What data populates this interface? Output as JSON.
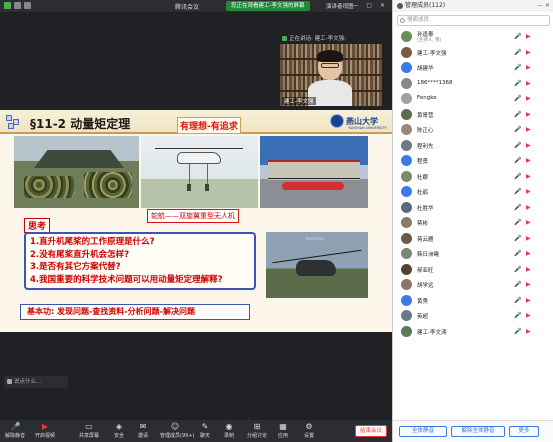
{
  "window": {
    "app_title": "腾讯会议",
    "banner": "您正在观看建工-李文强的屏幕",
    "gallery_button": "演讲者视图"
  },
  "speaker": {
    "label": "正在讲话: 建工-李文强;",
    "video_name": "建工-李文强"
  },
  "slide": {
    "title": "§11-2 动量矩定理",
    "tagline": "有理想-有追求",
    "logo_text": "燕山大学",
    "logo_sub": "YANSHAN UNIVERSITY",
    "caption": "鸵航——双旋翼重型无人机",
    "think_label": "思考",
    "questions": [
      "1.直升机尾桨的工作原理是什么?",
      "2.没有尾桨直升机会怎样?",
      "3.是否有其它方案代替?",
      "4.我国重要的科学技术问题可以用动量矩定理解释?"
    ],
    "basic": "基本功: 发现问题-查找资料-分析问题-解决问题",
    "watermark": "ammeno"
  },
  "chat_input": {
    "placeholder": "说点什么..."
  },
  "toolbar": {
    "items": [
      {
        "label": "解除静音",
        "icon": "mic-off-icon"
      },
      {
        "label": "开启视频",
        "icon": "camera-off-icon"
      },
      {
        "label": "共享屏幕",
        "icon": "share-screen-icon"
      },
      {
        "label": "安全",
        "icon": "shield-icon"
      },
      {
        "label": "邀请",
        "icon": "invite-icon"
      },
      {
        "label": "管理成员(99+)",
        "icon": "members-icon"
      },
      {
        "label": "聊天",
        "icon": "chat-icon",
        "badge": "99"
      },
      {
        "label": "录制",
        "icon": "record-icon"
      },
      {
        "label": "分组讨论",
        "icon": "breakout-icon"
      },
      {
        "label": "应用",
        "icon": "apps-icon"
      },
      {
        "label": "设置",
        "icon": "gear-icon"
      }
    ],
    "end_label": "结束会议"
  },
  "panel": {
    "title": "管理成员(112)",
    "search_placeholder": "搜索成员",
    "participants": [
      {
        "name": "孙逢泰",
        "sub": "(主持人, 我)",
        "color": "#6b8e5a"
      },
      {
        "name": "建工-李文强",
        "sub": "",
        "color": "#7a5c44"
      },
      {
        "name": "胡建华",
        "sub": "",
        "color": "#3b7be8"
      },
      {
        "name": "186****1368",
        "sub": "",
        "color": "#888"
      },
      {
        "name": "Fengke",
        "sub": "",
        "color": "#a0a0a0"
      },
      {
        "name": "黄哥营",
        "sub": "",
        "color": "#5a6e4a"
      },
      {
        "name": "陈正心",
        "sub": "",
        "color": "#998877"
      },
      {
        "name": "程利先",
        "sub": "",
        "color": "#6d7b8c"
      },
      {
        "name": "程勇",
        "sub": "",
        "color": "#3b7be8"
      },
      {
        "name": "杜娜",
        "sub": "",
        "color": "#7a8a6a"
      },
      {
        "name": "杜鹃",
        "sub": "",
        "color": "#3b7be8"
      },
      {
        "name": "杜胜华",
        "sub": "",
        "color": "#5c6a7c"
      },
      {
        "name": "蒋彬",
        "sub": "",
        "color": "#8a7a6a"
      },
      {
        "name": "蒋云雁",
        "sub": "",
        "color": "#6a5a4a"
      },
      {
        "name": "韩日洲曦",
        "sub": "",
        "color": "#778877"
      },
      {
        "name": "郝亚旺",
        "sub": "",
        "color": "#554433"
      },
      {
        "name": "胡学远",
        "sub": "",
        "color": "#887766"
      },
      {
        "name": "黄秀",
        "sub": "",
        "color": "#3b7be8"
      },
      {
        "name": "英超",
        "sub": "",
        "color": "#6a7a8a"
      },
      {
        "name": "建工-李文涛",
        "sub": "",
        "color": "#5a7a5a"
      }
    ],
    "mute_all": "全体静音",
    "unmute_all": "解除全体静音",
    "more": "更多"
  }
}
